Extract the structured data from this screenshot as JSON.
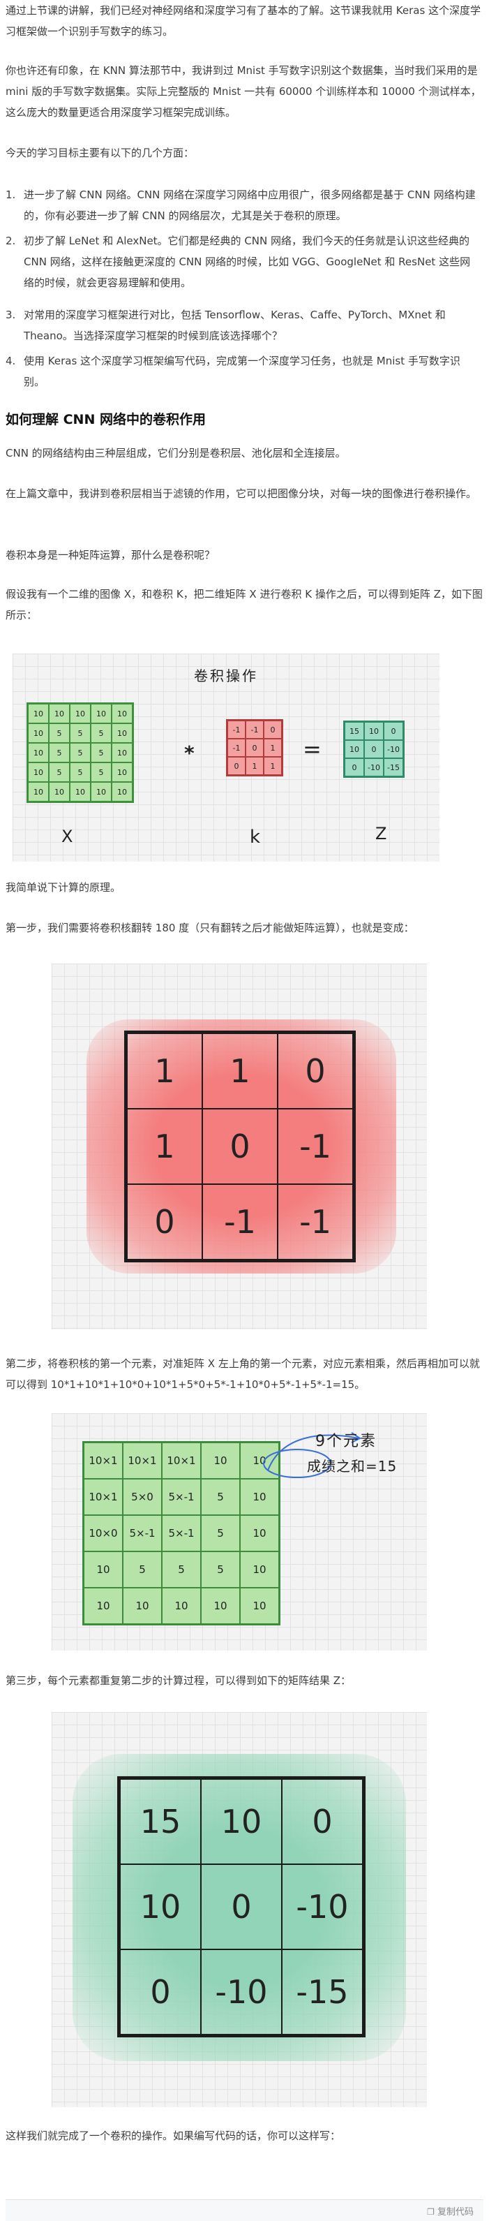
{
  "intro": {
    "p1": "通过上节课的讲解，我们已经对神经网络和深度学习有了基本的了解。这节课我就用 Keras 这个深度学习框架做一个识别手写数字的练习。",
    "p2": "你也许还有印象，在 KNN 算法那节中，我讲到过 Mnist 手写数字识别这个数据集，当时我们采用的是 mini 版的手写数字数据集。实际上完整版的 Mnist 一共有 60000 个训练样本和 10000 个测试样本，这么庞大的数量更适合用深度学习框架完成训练。",
    "p3": "今天的学习目标主要有以下的几个方面："
  },
  "goals": [
    {
      "num": "1.",
      "text": "进一步了解 CNN 网络。CNN 网络在深度学习网络中应用很广，很多网络都是基于 CNN 网络构建的，你有必要进一步了解 CNN 的网络层次，尤其是关于卷积的原理。"
    },
    {
      "num": "2.",
      "text": "初步了解 LeNet 和 AlexNet。它们都是经典的 CNN 网络，我们今天的任务就是认识这些经典的 CNN 网络，这样在接触更深度的 CNN 网络的时候，比如 VGG、GoogleNet 和 ResNet 这些网络的时候，就会更容易理解和使用。"
    },
    {
      "num": "3.",
      "text": "对常用的深度学习框架进行对比，包括 Tensorflow、Keras、Caffe、PyTorch、MXnet 和 Theano。当选择深度学习框架的时候到底该选择哪个？"
    },
    {
      "num": "4.",
      "text": "使用 Keras 这个深度学习框架编写代码，完成第一个深度学习任务，也就是 Mnist 手写数字识别。"
    }
  ],
  "section_title": "如何理解 CNN 网络中的卷积作用",
  "body": {
    "p4": "CNN 的网络结构由三种层组成，它们分别是卷积层、池化层和全连接层。",
    "p5": "在上篇文章中，我讲到卷积层相当于滤镜的作用，它可以把图像分块，对每一块的图像进行卷积操作。",
    "p6": "卷积本身是一种矩阵运算，那什么是卷积呢？",
    "p7": "假设我有一个二维的图像 X，和卷积 K，把二维矩阵 X 进行卷积 K 操作之后，可以得到矩阵 Z，如下图所示：",
    "p8": "我简单说下计算的原理。",
    "p9": "第一步，我们需要将卷积核翻转 180 度（只有翻转之后才能做矩阵运算），也就是变成：",
    "p10": "第二步，将卷积核的第一个元素，对准矩阵 X 左上角的第一个元素，对应元素相乘，然后再相加可以就可以得到 10*1+10*1+10*0+10*1+5*0+5*-1+10*0+5*-1+5*-1=15。",
    "p11": "第三步，每个元素都重复第二步的计算过程，可以得到如下的矩阵结果 Z：",
    "p12": "这样我们就完成了一个卷积的操作。如果编写代码的话，你可以这样写："
  },
  "fig1": {
    "title": "卷积操作",
    "x_matrix": [
      [
        "10",
        "10",
        "10",
        "10",
        "10"
      ],
      [
        "10",
        "5",
        "5",
        "5",
        "10"
      ],
      [
        "10",
        "5",
        "5",
        "5",
        "10"
      ],
      [
        "10",
        "5",
        "5",
        "5",
        "10"
      ],
      [
        "10",
        "10",
        "10",
        "10",
        "10"
      ]
    ],
    "k_matrix": [
      [
        "-1",
        "-1",
        "0"
      ],
      [
        "-1",
        "0",
        "1"
      ],
      [
        "0",
        "1",
        "1"
      ]
    ],
    "z_matrix": [
      [
        "15",
        "10",
        "0"
      ],
      [
        "10",
        "0",
        "-10"
      ],
      [
        "0",
        "-10",
        "-15"
      ]
    ],
    "star": "*",
    "equals": "=",
    "label_x": "X",
    "label_k": "k",
    "label_z": "Z",
    "colors": {
      "green": "#b6e3a8",
      "red": "#f2a0a0",
      "teal": "#9fdcc4"
    }
  },
  "fig2": {
    "matrix": [
      [
        "1",
        "1",
        "0"
      ],
      [
        "1",
        "0",
        "-1"
      ],
      [
        "0",
        "-1",
        "-1"
      ]
    ],
    "color": "#f48f8f"
  },
  "fig3": {
    "matrix": [
      [
        "10×1",
        "10×1",
        "10×1",
        "10",
        "10"
      ],
      [
        "10×1",
        "5×0",
        "5×-1",
        "5",
        "10"
      ],
      [
        "10×0",
        "5×-1",
        "5×-1",
        "5",
        "10"
      ],
      [
        "10",
        "5",
        "5",
        "5",
        "10"
      ],
      [
        "10",
        "10",
        "10",
        "10",
        "10"
      ]
    ],
    "note_line1": "9个元素",
    "note_line2": "成绩之和=15",
    "color": "#b6e3a8"
  },
  "fig4": {
    "matrix": [
      [
        "15",
        "10",
        "0"
      ],
      [
        "10",
        "0",
        "-10"
      ],
      [
        "0",
        "-10",
        "-15"
      ]
    ],
    "color": "#a6dcc4"
  },
  "copy_label": "复制代码"
}
